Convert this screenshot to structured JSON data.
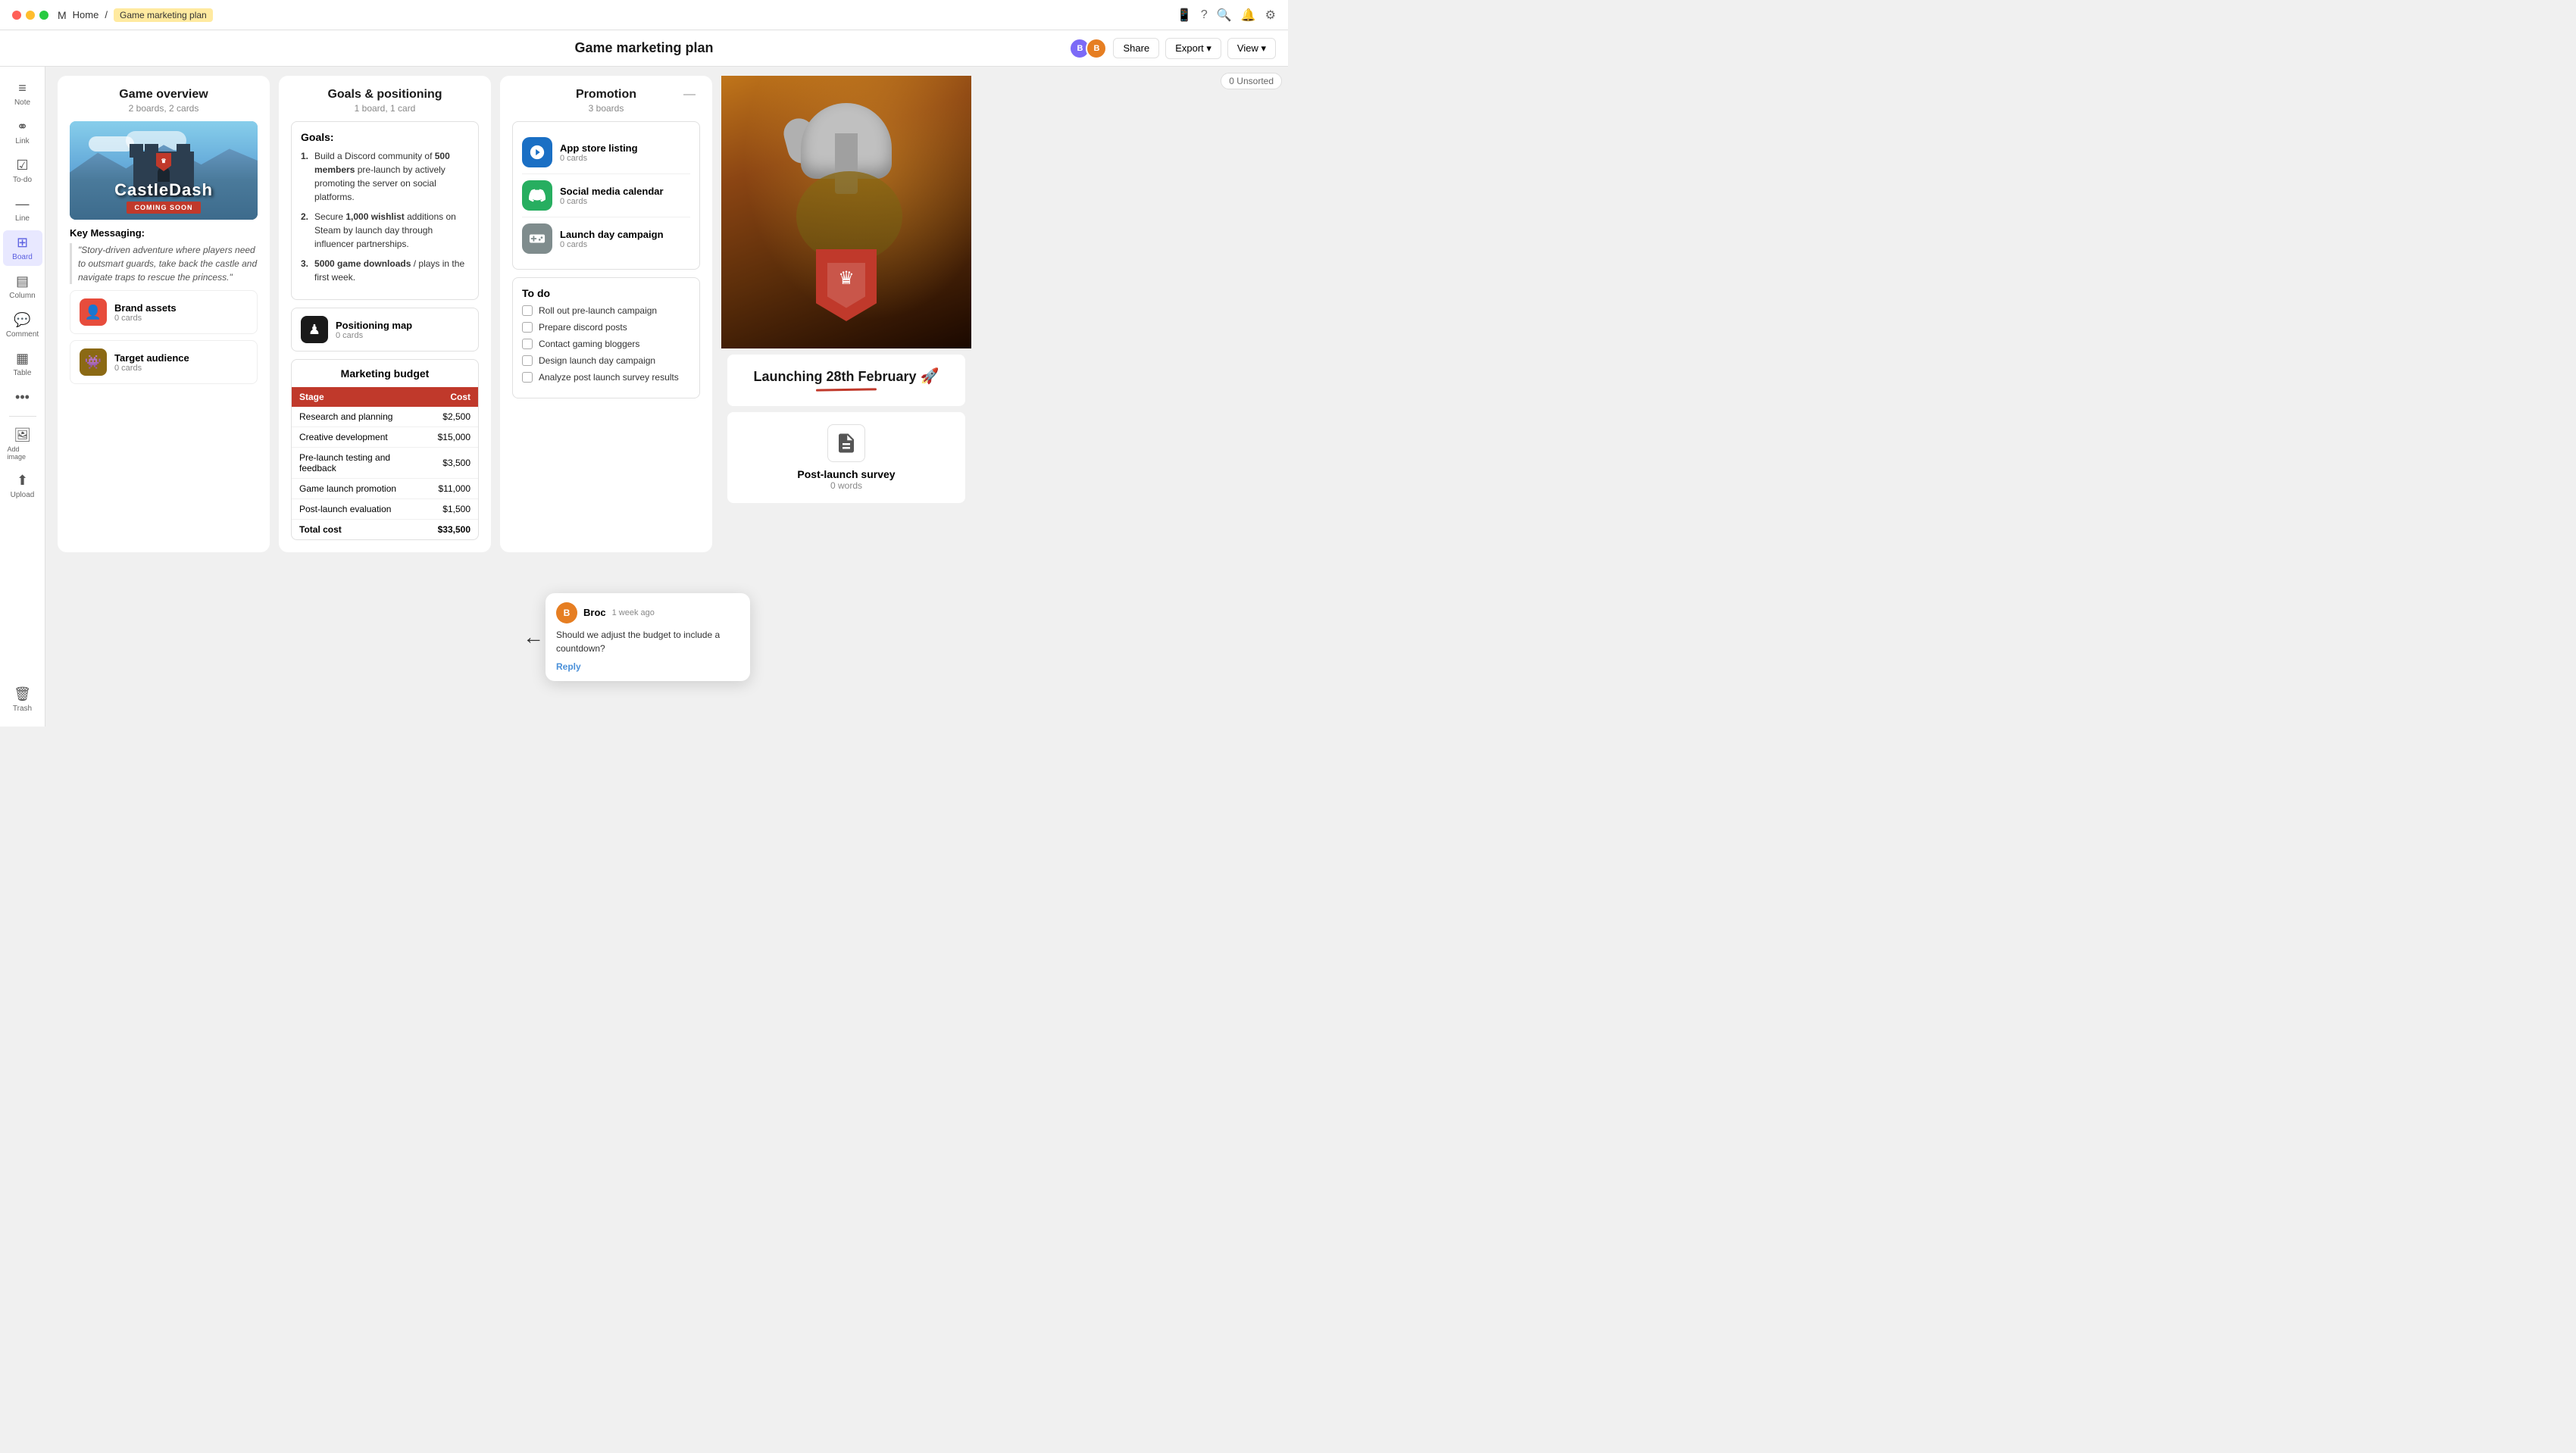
{
  "window": {
    "title": "Game marketing plan",
    "breadcrumb_home": "Home",
    "breadcrumb_sep": "/",
    "breadcrumb_page": "Game marketing plan"
  },
  "header": {
    "title": "Game marketing plan",
    "share_label": "Share",
    "export_label": "Export",
    "view_label": "View",
    "unsorted_label": "0 Unsorted"
  },
  "sidebar": {
    "items": [
      {
        "label": "Note",
        "icon": "≡"
      },
      {
        "label": "Link",
        "icon": "🔗"
      },
      {
        "label": "To-do",
        "icon": "☑"
      },
      {
        "label": "Line",
        "icon": "—"
      },
      {
        "label": "Board",
        "icon": "⊞"
      },
      {
        "label": "Column",
        "icon": "▤"
      },
      {
        "label": "Comment",
        "icon": "💬"
      },
      {
        "label": "Table",
        "icon": "▦"
      },
      {
        "label": "More",
        "icon": "•••"
      },
      {
        "label": "Add image",
        "icon": "🖼"
      },
      {
        "label": "Upload",
        "icon": "⬆"
      },
      {
        "label": "Trash",
        "icon": "🗑"
      }
    ]
  },
  "game_overview": {
    "title": "Game overview",
    "subtitle": "2 boards, 2 cards",
    "game_name": "CastleDash",
    "coming_soon": "COMING SOON",
    "key_messaging_title": "Key Messaging:",
    "key_messaging_quote": "\"Story-driven adventure where players need to outsmart guards, take back the castle and navigate traps to rescue the princess.\"",
    "brand_assets": {
      "name": "Brand assets",
      "count": "0 cards"
    },
    "target_audience": {
      "name": "Target audience",
      "count": "0 cards"
    }
  },
  "goals_positioning": {
    "title": "Goals & positioning",
    "subtitle": "1 board, 1 card",
    "goals_title": "Goals:",
    "goals": [
      {
        "num": "1.",
        "text": "Build a Discord community of 500 members pre-launch by actively promoting the server on social platforms.",
        "bold": "500 members"
      },
      {
        "num": "2.",
        "text": "Secure 1,000 wishlist additions on Steam by launch day through influencer partnerships.",
        "bold": "1,000 wishlist"
      },
      {
        "num": "3.",
        "text": "5000 game downloads / plays in the first week.",
        "bold": "5000 game downloads"
      }
    ],
    "positioning_map": {
      "name": "Positioning map",
      "count": "0 cards"
    },
    "budget": {
      "title": "Marketing budget",
      "col_stage": "Stage",
      "col_cost": "Cost",
      "rows": [
        {
          "stage": "Research and planning",
          "cost": "$2,500"
        },
        {
          "stage": "Creative development",
          "cost": "$15,000"
        },
        {
          "stage": "Pre-launch testing and feedback",
          "cost": "$3,500"
        },
        {
          "stage": "Game launch promotion",
          "cost": "$11,000"
        },
        {
          "stage": "Post-launch evaluation",
          "cost": "$1,500"
        },
        {
          "stage": "Total cost",
          "cost": "$33,500"
        }
      ]
    }
  },
  "promotion": {
    "title": "Promotion",
    "subtitle": "3 boards",
    "boards": [
      {
        "name": "App store listing",
        "count": "0 cards",
        "icon_type": "steam"
      },
      {
        "name": "Social media calendar",
        "count": "0 cards",
        "icon_type": "discord"
      },
      {
        "name": "Launch day campaign",
        "count": "0 cards",
        "icon_type": "gamepad"
      }
    ],
    "todo_title": "To do",
    "todos": [
      "Roll out pre-launch campaign",
      "Prepare discord posts",
      "Contact gaming bloggers",
      "Design launch day campaign",
      "Analyze post launch survey results"
    ]
  },
  "right_panel": {
    "launch_title": "Launching 28th February",
    "launch_emoji": "🚀",
    "survey": {
      "name": "Post-launch survey",
      "count": "0 words"
    }
  },
  "comment": {
    "author": "Broc",
    "time": "1 week ago",
    "text": "Should we adjust the budget to include a countdown?",
    "reply_label": "Reply"
  }
}
